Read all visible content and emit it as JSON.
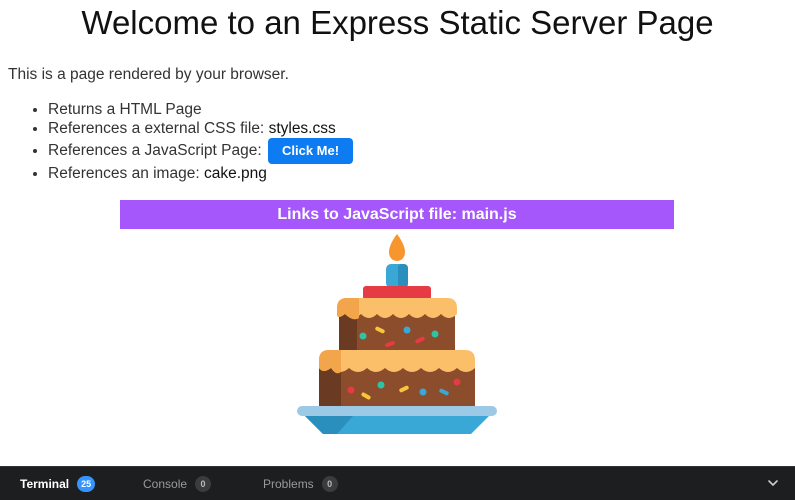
{
  "page": {
    "heading": "Welcome to an Express Static Server Page",
    "intro": "This is a page rendered by your browser.",
    "list": {
      "item1": "Returns a HTML Page",
      "item2_prefix": "References a external CSS file:",
      "item2_strong": "styles.css",
      "item3_prefix": "References a JavaScript Page:",
      "button_label": "Click Me!",
      "item4_prefix": "References an image:",
      "item4_strong": "cake.png"
    },
    "banner": "Links to JavaScript file: main.js",
    "image": {
      "icon": "cake-image"
    }
  },
  "panel": {
    "tabs": [
      {
        "label": "Terminal",
        "badge": "25",
        "active": true
      },
      {
        "label": "Console",
        "badge": "0",
        "active": false
      },
      {
        "label": "Problems",
        "badge": "0",
        "active": false
      }
    ],
    "collapse_icon": "chevron-down-icon"
  },
  "colors": {
    "button": "#0d7bf2",
    "banner": "#a557fb",
    "panel_bg": "#1d1e1f",
    "terminal_badge": "#3794ff"
  }
}
